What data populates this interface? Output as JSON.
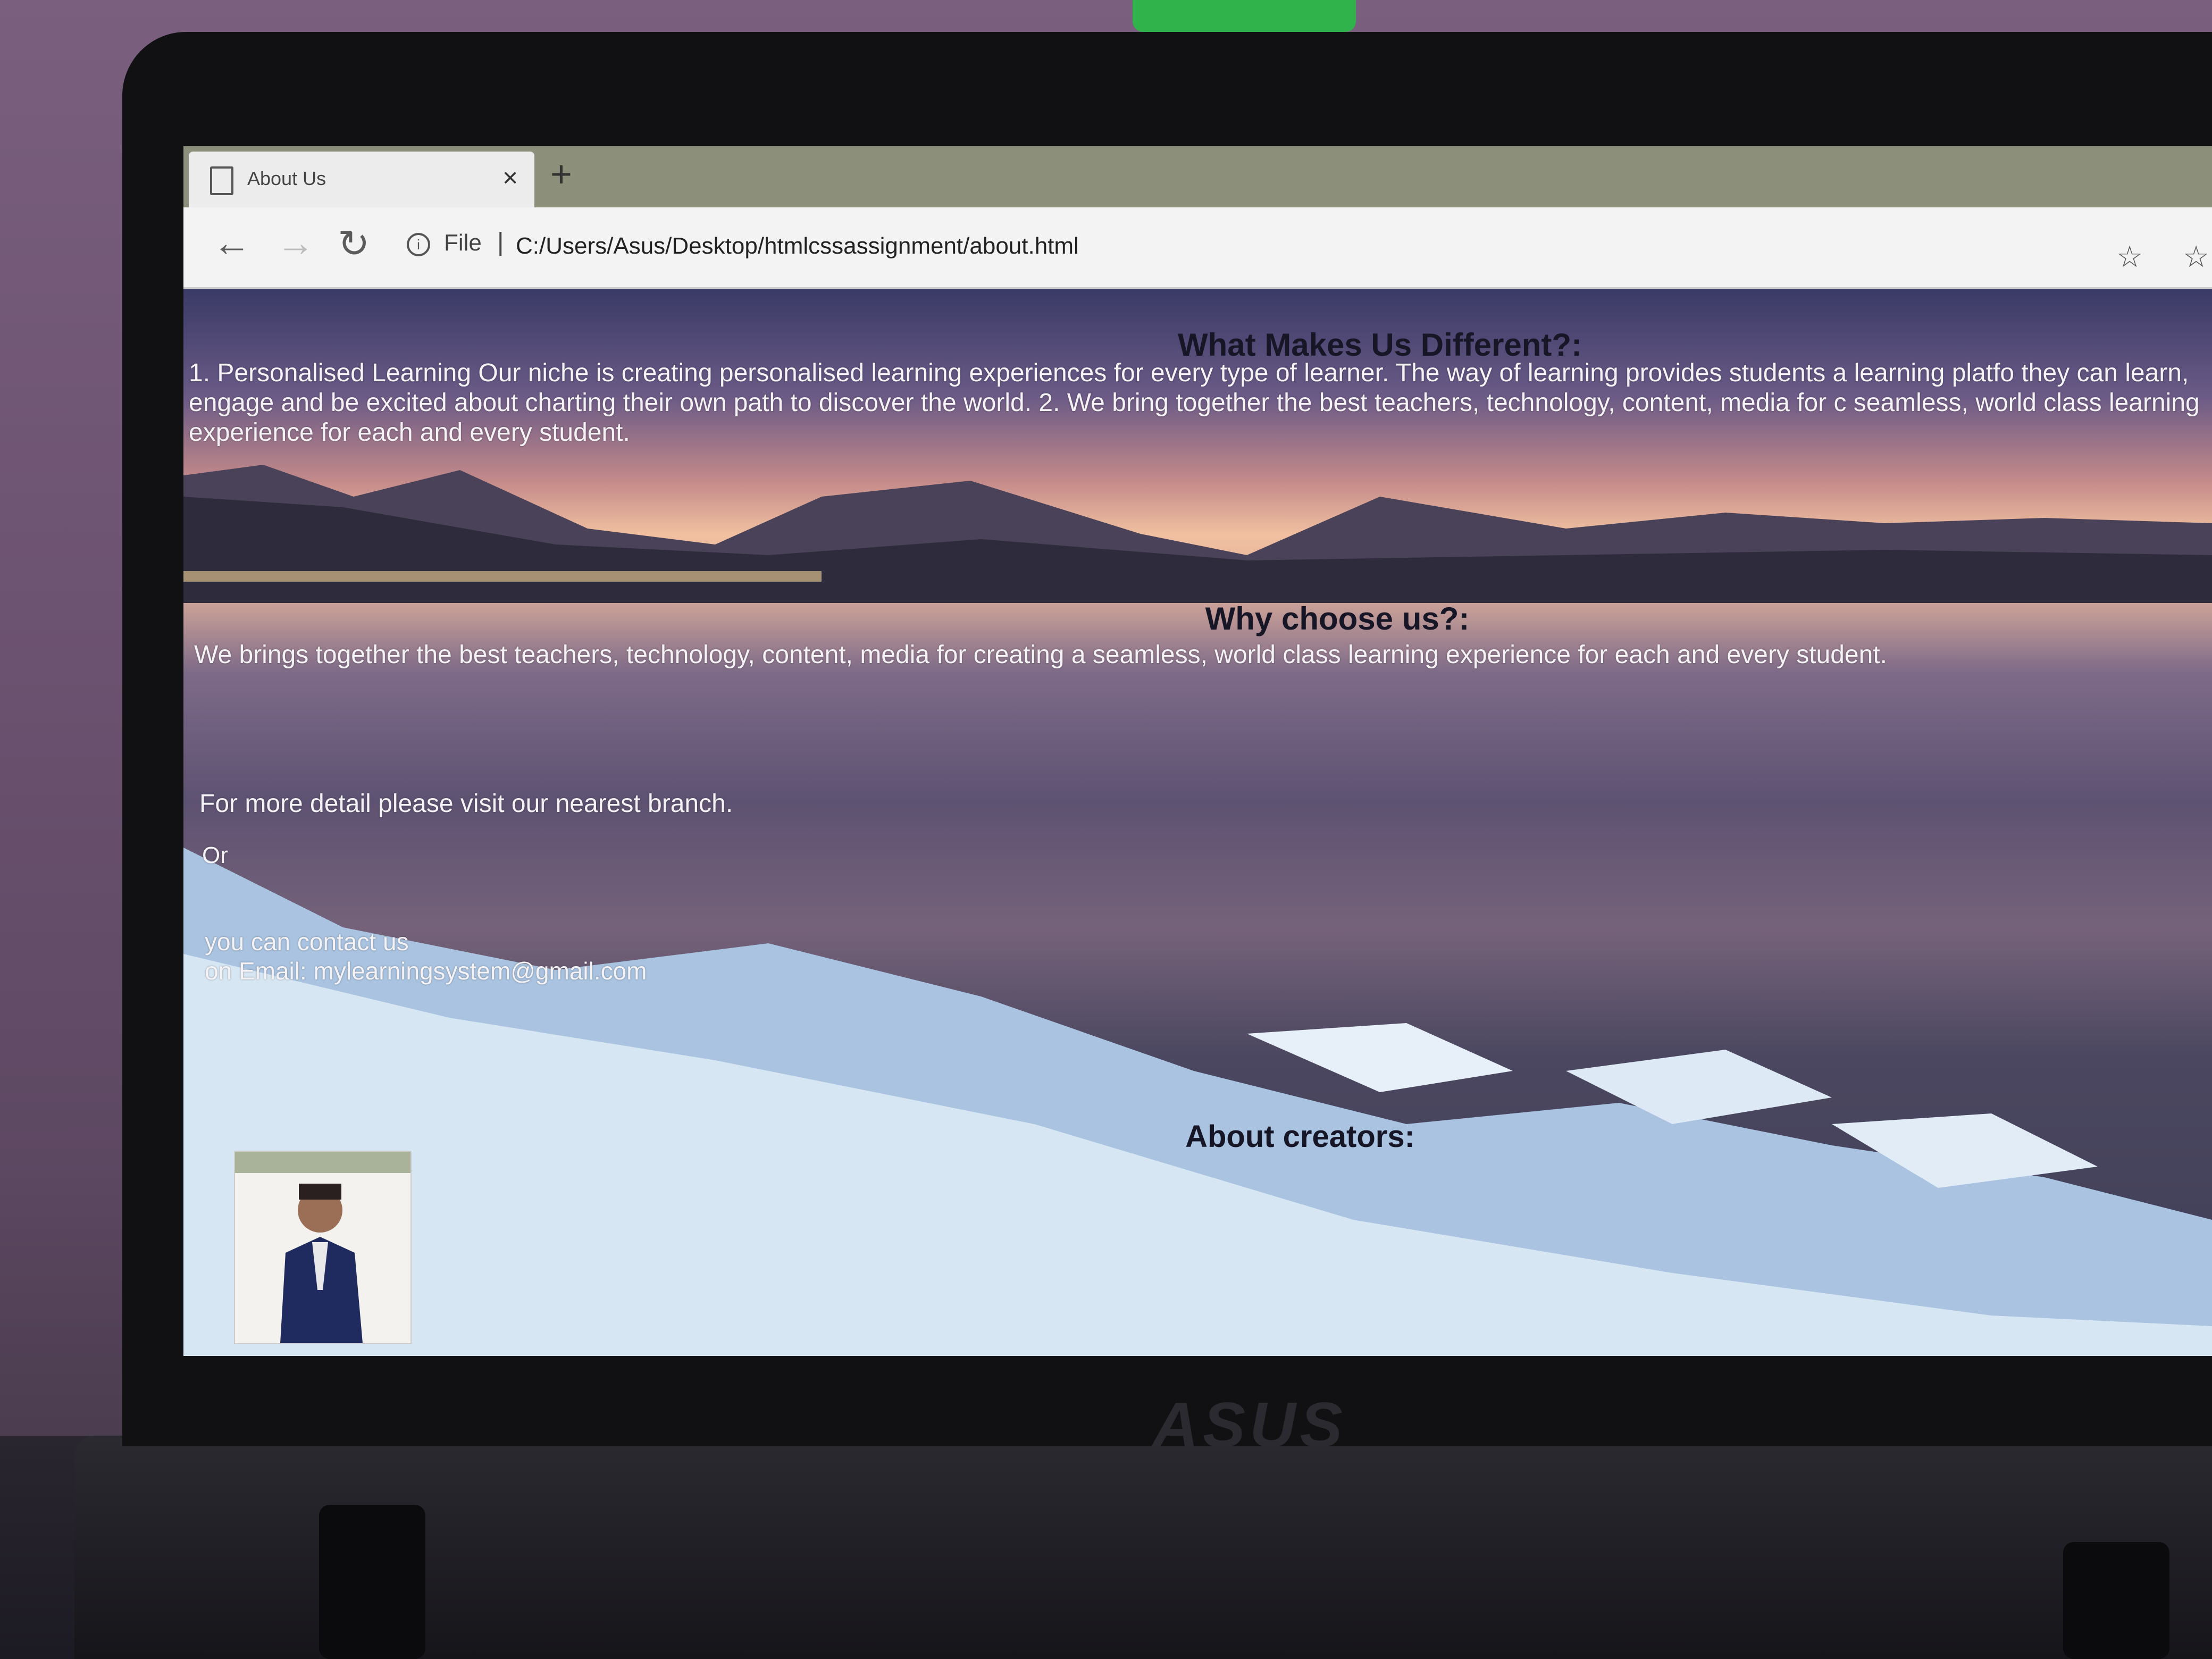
{
  "browser": {
    "tab_title": "About Us",
    "tab_close": "×",
    "new_tab": "+",
    "back_icon": "←",
    "forward_icon": "→",
    "refresh_icon": "↻",
    "info_icon": "i",
    "scheme_label": "File",
    "separator": "|",
    "url": "C:/Users/Asus/Desktop/htmlcssassignment/about.html",
    "favorite_icon": "☆",
    "favorites_bar_icon": "☆"
  },
  "page": {
    "heading_different": "What Makes Us Different?:",
    "different_text": "1. Personalised Learning Our niche is creating personalised learning experiences for every type of learner. The way of learning provides students a learning platfo they can learn, engage and be excited about charting their own path to discover the world. 2. We bring together the best teachers, technology, content, media for c seamless, world class learning experience for each and every student.",
    "heading_why": "Why choose us?:",
    "why_text": "We brings together the best teachers, technology, content, media for creating a seamless, world class learning experience for each and every student.",
    "detail_text": "For more detail please visit our nearest branch.",
    "or_text": "Or",
    "contact_line1": "you can contact us",
    "contact_line2": "on Email: mylearningsystem@gmail.com",
    "heading_creators": "About creators:"
  },
  "device": {
    "brand": "ASUS"
  }
}
